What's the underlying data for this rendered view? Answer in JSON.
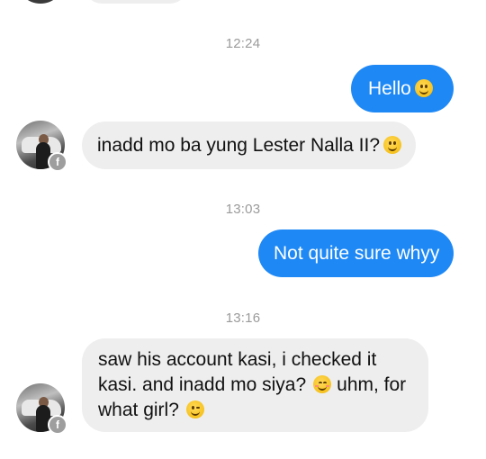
{
  "conversation": {
    "messages": [
      {
        "type": "timestamp",
        "text": "12:24"
      },
      {
        "type": "outgoing",
        "text": "Hello",
        "emoji": "smile-emoji"
      },
      {
        "type": "incoming",
        "text": "inadd mo ba yung Lester Nalla II?",
        "emoji": "smile-emoji"
      },
      {
        "type": "timestamp",
        "text": "13:03"
      },
      {
        "type": "outgoing",
        "text": "Not quite sure whyy"
      },
      {
        "type": "timestamp",
        "text": "13:16"
      },
      {
        "type": "incoming",
        "lines": [
          "saw his account kasi, i checked it",
          "kasi. and inadd mo siya?",
          "uhm, for",
          "what girl?"
        ],
        "emojis": [
          "blush-emoji",
          "wink-emoji"
        ]
      }
    ]
  },
  "contact": {
    "avatar_badge": "f",
    "badge_icon": "facebook-icon"
  },
  "colors": {
    "outgoing_bubble": "#1e88f5",
    "incoming_bubble": "#eeeeee",
    "timestamp_text": "#9b9b9b"
  }
}
